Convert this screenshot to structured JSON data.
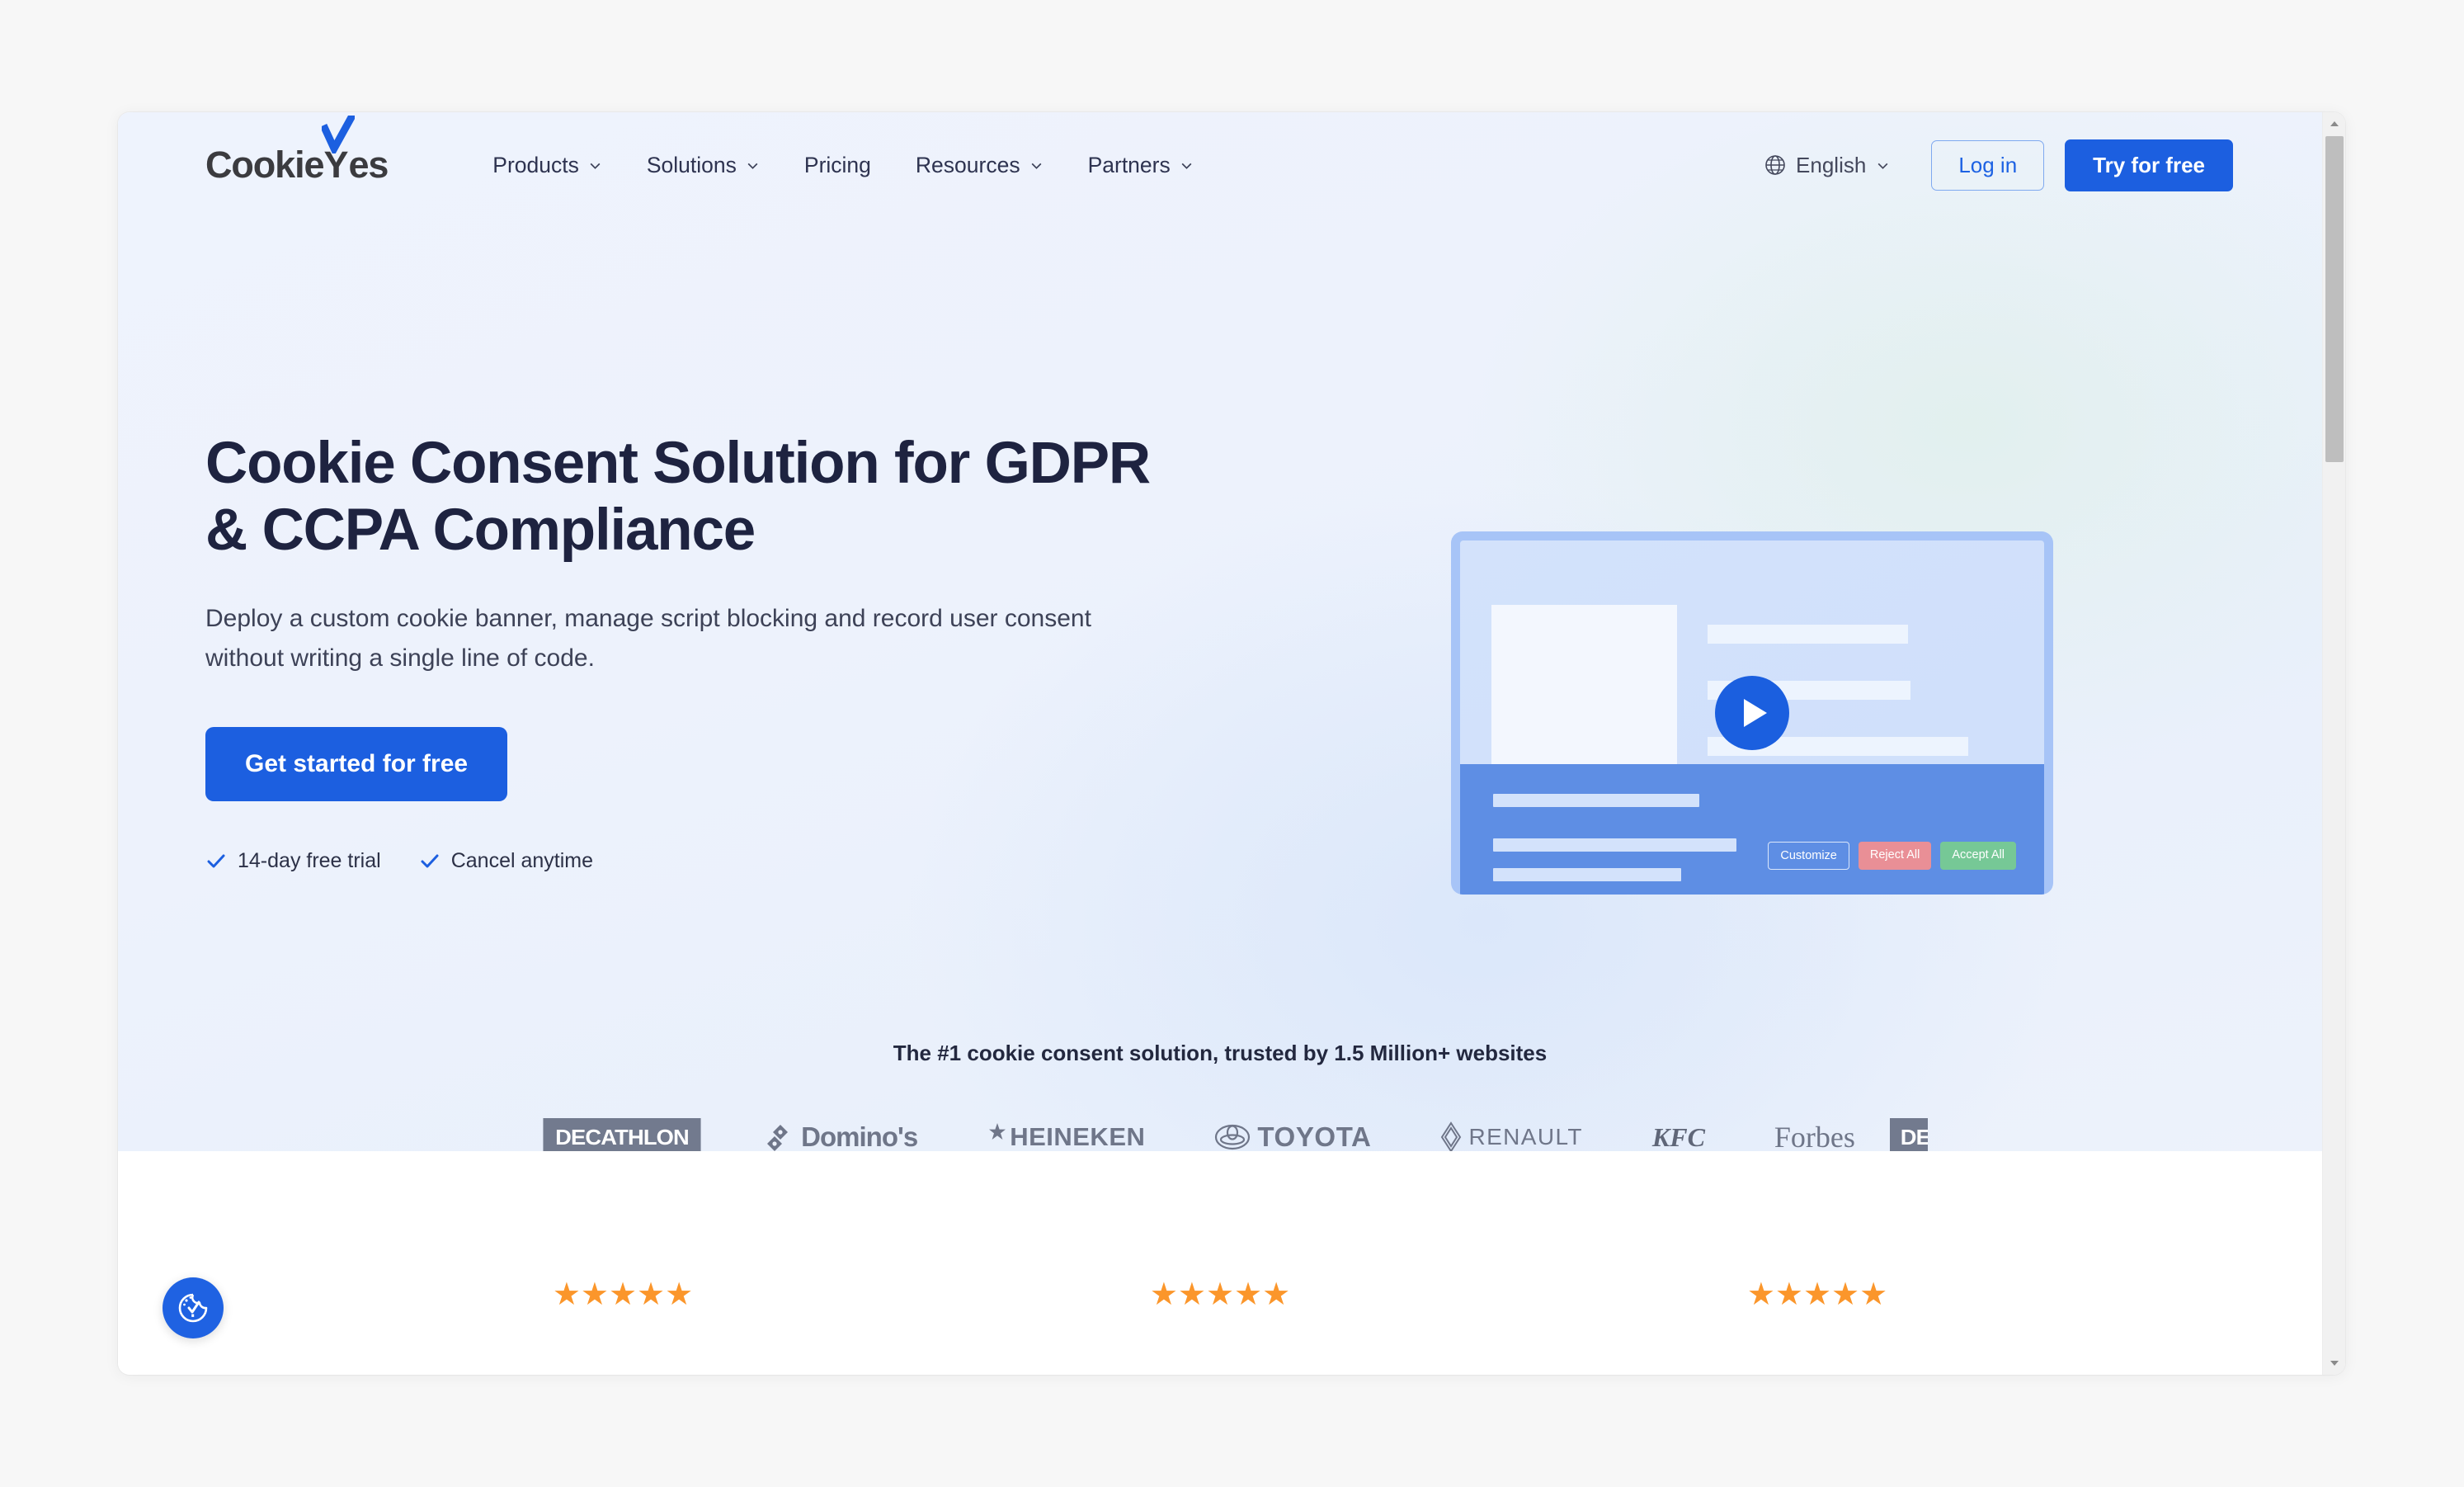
{
  "header": {
    "logo": {
      "text_dark_1": "Cookie",
      "text_y": "Y",
      "text_dark_2": "es",
      "icon": "check-icon"
    },
    "nav_items": [
      {
        "label": "Products",
        "has_dropdown": true
      },
      {
        "label": "Solutions",
        "has_dropdown": true
      },
      {
        "label": "Pricing",
        "has_dropdown": false
      },
      {
        "label": "Resources",
        "has_dropdown": true
      },
      {
        "label": "Partners",
        "has_dropdown": true
      }
    ],
    "language": {
      "label": "English",
      "icon": "globe-icon"
    },
    "login_label": "Log in",
    "try_label": "Try for free"
  },
  "hero": {
    "title": "Cookie Consent Solution for GDPR & CCPA Compliance",
    "subtitle": "Deploy a custom cookie banner, manage script blocking and record user consent without writing a single line of code.",
    "cta_label": "Get started for free",
    "trust_items": [
      {
        "label": "14-day free trial",
        "icon": "check-icon"
      },
      {
        "label": "Cancel anytime",
        "icon": "check-icon"
      }
    ]
  },
  "mockup": {
    "play_icon": "play-icon",
    "banner_buttons": [
      {
        "label": "Customize",
        "style": "outline"
      },
      {
        "label": "Reject All",
        "style": "red"
      },
      {
        "label": "Accept All",
        "style": "green"
      }
    ]
  },
  "trusted": {
    "headline": "The #1 cookie consent solution, trusted by 1.5 Million+ websites",
    "brands": [
      {
        "name": "DECATHLON",
        "style": "decathlon"
      },
      {
        "name": "Domino's",
        "style": "dominos"
      },
      {
        "name": "HEINEKEN",
        "style": "heineken"
      },
      {
        "name": "TOYOTA",
        "style": "toyota"
      },
      {
        "name": "RENAULT",
        "style": "renault"
      },
      {
        "name": "KFC",
        "style": "kfc"
      },
      {
        "name": "Forbes",
        "style": "forbes"
      },
      {
        "name": "DEC",
        "style": "decathlon-clipped"
      }
    ]
  },
  "reviews": {
    "rating_value": 5,
    "star_glyph": "★",
    "star_color": "#fb962b",
    "rows": [
      {
        "stars": "★★★★★"
      },
      {
        "stars": "★★★★★"
      },
      {
        "stars": "★★★★★"
      }
    ]
  },
  "cookie_widget": {
    "icon": "cookie-consent-icon"
  },
  "scrollbar": {
    "up_icon": "scroll-up-arrow",
    "down_icon": "scroll-down-arrow"
  },
  "colors": {
    "brand_blue": "#1c5fe0",
    "hero_bg": "#eef2fc",
    "text_dark": "#1e2340",
    "star_orange": "#fb962b",
    "banner_blue": "#5e8ee4",
    "reject_red": "#e98f96",
    "accept_green": "#76c896"
  }
}
